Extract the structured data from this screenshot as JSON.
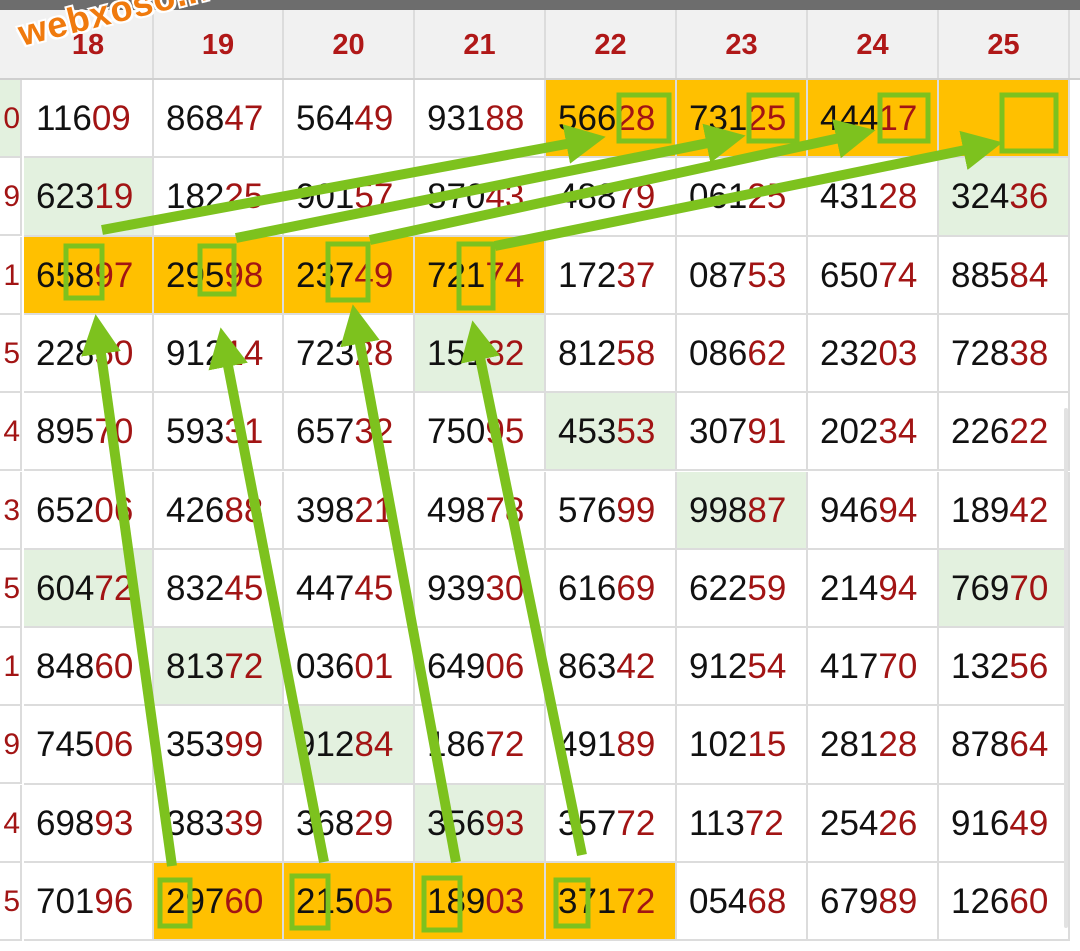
{
  "watermark": "webxoso.net",
  "colors": {
    "highlight": "#ffc000",
    "green_cell": "#e3f1df",
    "suffix_red": "#a21414",
    "arrow_green": "#7dc21e"
  },
  "columns": [
    "18",
    "19",
    "20",
    "21",
    "22",
    "23",
    "24",
    "25"
  ],
  "left_edge": [
    "0",
    "9",
    "1",
    "5",
    "4",
    "3",
    "5",
    "1",
    "9",
    "4",
    "5"
  ],
  "left_edge_green": [
    true,
    false,
    false,
    false,
    false,
    false,
    false,
    false,
    false,
    false,
    false
  ],
  "rows": [
    [
      {
        "p": "116",
        "s": "09"
      },
      {
        "p": "868",
        "s": "47"
      },
      {
        "p": "564",
        "s": "49"
      },
      {
        "p": "931",
        "s": "88"
      },
      {
        "p": "566",
        "s": "28",
        "bg": "hl"
      },
      {
        "p": "731",
        "s": "25",
        "bg": "hl"
      },
      {
        "p": "444",
        "s": "17",
        "bg": "hl"
      },
      {
        "p": "",
        "s": "",
        "bg": "hl"
      }
    ],
    [
      {
        "p": "623",
        "s": "19",
        "bg": "gr"
      },
      {
        "p": "182",
        "s": "25"
      },
      {
        "p": "901",
        "s": "57"
      },
      {
        "p": "870",
        "s": "43"
      },
      {
        "p": "488",
        "s": "79"
      },
      {
        "p": "061",
        "s": "25"
      },
      {
        "p": "431",
        "s": "28"
      },
      {
        "p": "324",
        "s": "36",
        "bg": "gr"
      }
    ],
    [
      {
        "p": "658",
        "s": "97",
        "bg": "hl"
      },
      {
        "p": "295",
        "s": "98",
        "bg": "hl"
      },
      {
        "p": "237",
        "s": "49",
        "bg": "hl"
      },
      {
        "p": "721",
        "s": "74",
        "bg": "hl"
      },
      {
        "p": "172",
        "s": "37"
      },
      {
        "p": "087",
        "s": "53"
      },
      {
        "p": "650",
        "s": "74"
      },
      {
        "p": "885",
        "s": "84"
      }
    ],
    [
      {
        "p": "228",
        "s": "50"
      },
      {
        "p": "912",
        "s": "14"
      },
      {
        "p": "723",
        "s": "28"
      },
      {
        "p": "151",
        "s": "32",
        "bg": "gr"
      },
      {
        "p": "812",
        "s": "58"
      },
      {
        "p": "086",
        "s": "62"
      },
      {
        "p": "232",
        "s": "03"
      },
      {
        "p": "728",
        "s": "38"
      }
    ],
    [
      {
        "p": "895",
        "s": "70"
      },
      {
        "p": "593",
        "s": "31"
      },
      {
        "p": "657",
        "s": "32"
      },
      {
        "p": "750",
        "s": "95"
      },
      {
        "p": "453",
        "s": "53",
        "bg": "gr"
      },
      {
        "p": "307",
        "s": "91"
      },
      {
        "p": "202",
        "s": "34"
      },
      {
        "p": "226",
        "s": "22"
      }
    ],
    [
      {
        "p": "652",
        "s": "06"
      },
      {
        "p": "426",
        "s": "88"
      },
      {
        "p": "398",
        "s": "21"
      },
      {
        "p": "498",
        "s": "78"
      },
      {
        "p": "576",
        "s": "99"
      },
      {
        "p": "998",
        "s": "87",
        "bg": "gr"
      },
      {
        "p": "946",
        "s": "94"
      },
      {
        "p": "189",
        "s": "42"
      }
    ],
    [
      {
        "p": "604",
        "s": "72",
        "bg": "gr"
      },
      {
        "p": "832",
        "s": "45"
      },
      {
        "p": "447",
        "s": "45"
      },
      {
        "p": "939",
        "s": "30"
      },
      {
        "p": "616",
        "s": "69"
      },
      {
        "p": "622",
        "s": "59"
      },
      {
        "p": "214",
        "s": "94"
      },
      {
        "p": "769",
        "s": "70",
        "bg": "gr"
      }
    ],
    [
      {
        "p": "848",
        "s": "60"
      },
      {
        "p": "813",
        "s": "72",
        "bg": "gr"
      },
      {
        "p": "036",
        "s": "01"
      },
      {
        "p": "649",
        "s": "06"
      },
      {
        "p": "863",
        "s": "42"
      },
      {
        "p": "912",
        "s": "54"
      },
      {
        "p": "417",
        "s": "70"
      },
      {
        "p": "132",
        "s": "56"
      }
    ],
    [
      {
        "p": "745",
        "s": "06"
      },
      {
        "p": "353",
        "s": "99"
      },
      {
        "p": "912",
        "s": "84",
        "bg": "gr"
      },
      {
        "p": "186",
        "s": "72"
      },
      {
        "p": "491",
        "s": "89"
      },
      {
        "p": "102",
        "s": "15"
      },
      {
        "p": "281",
        "s": "28"
      },
      {
        "p": "878",
        "s": "64"
      }
    ],
    [
      {
        "p": "698",
        "s": "93"
      },
      {
        "p": "383",
        "s": "39"
      },
      {
        "p": "368",
        "s": "29"
      },
      {
        "p": "356",
        "s": "93",
        "bg": "gr"
      },
      {
        "p": "357",
        "s": "72"
      },
      {
        "p": "113",
        "s": "72"
      },
      {
        "p": "254",
        "s": "26"
      },
      {
        "p": "916",
        "s": "49"
      }
    ],
    [
      {
        "p": "701",
        "s": "96"
      },
      {
        "p": "297",
        "s": "60",
        "bg": "hl"
      },
      {
        "p": "215",
        "s": "05",
        "bg": "hl"
      },
      {
        "p": "189",
        "s": "03",
        "bg": "hl"
      },
      {
        "p": "371",
        "s": "72",
        "bg": "hl"
      },
      {
        "p": "054",
        "s": "68"
      },
      {
        "p": "679",
        "s": "89"
      },
      {
        "p": "126",
        "s": "60"
      }
    ]
  ]
}
